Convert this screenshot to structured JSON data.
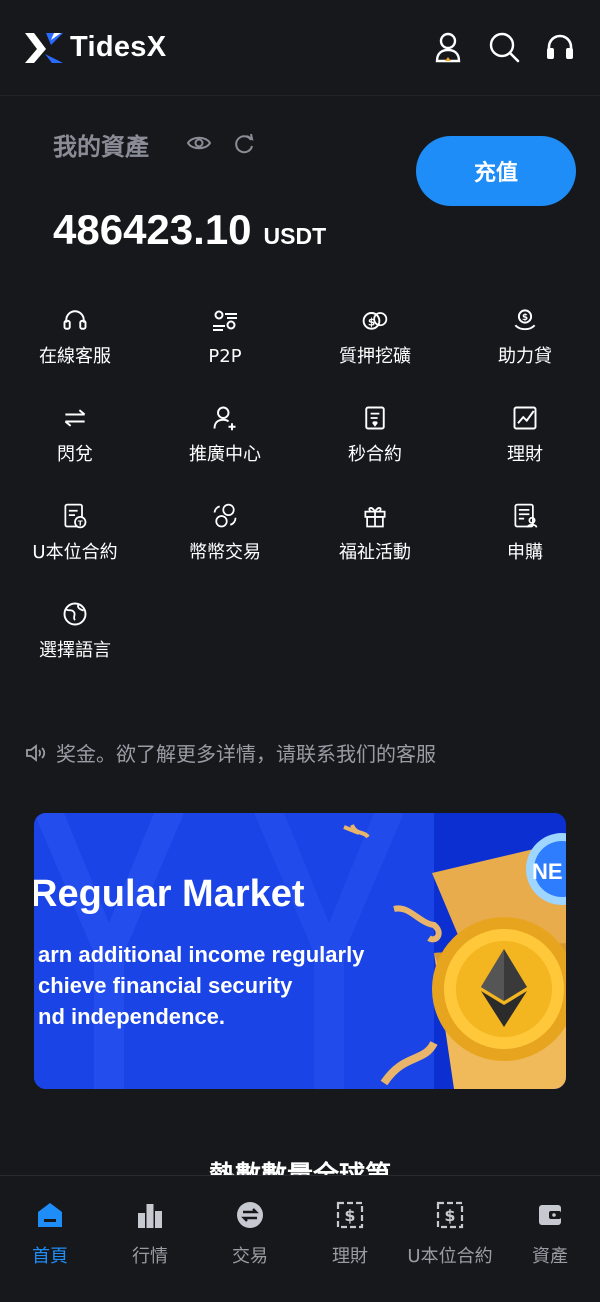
{
  "header": {
    "brand": "TidesX"
  },
  "assets": {
    "title": "我的資產",
    "amount": "486423.10",
    "unit": "USDT",
    "deposit_label": "充值"
  },
  "grid": [
    {
      "label": "在線客服",
      "icon": "headset-icon"
    },
    {
      "label": "P2P",
      "icon": "p2p-icon"
    },
    {
      "label": "質押挖礦",
      "icon": "coins-icon"
    },
    {
      "label": "助力貸",
      "icon": "loan-icon"
    },
    {
      "label": "閃兌",
      "icon": "swap-icon"
    },
    {
      "label": "推廣中心",
      "icon": "user-add-icon"
    },
    {
      "label": "秒合約",
      "icon": "contract-icon"
    },
    {
      "label": "理財",
      "icon": "chart-icon"
    },
    {
      "label": "U本位合約",
      "icon": "u-contract-icon"
    },
    {
      "label": "幣幣交易",
      "icon": "coin-exchange-icon"
    },
    {
      "label": "福祉活動",
      "icon": "gift-icon"
    },
    {
      "label": "申購",
      "icon": "subscribe-icon"
    },
    {
      "label": "選擇語言",
      "icon": "globe-icon"
    }
  ],
  "notice": {
    "text": "奖金。欲了解更多详情，请联系我们的客服"
  },
  "banner": {
    "title": "Regular Market",
    "lines": [
      "arn additional income regularly",
      "chieve financial security",
      "nd independence."
    ],
    "badge": "NE"
  },
  "section": {
    "title": "熱數數量全球第"
  },
  "nav": [
    {
      "label": "首頁",
      "active": true
    },
    {
      "label": "行情",
      "active": false
    },
    {
      "label": "交易",
      "active": false
    },
    {
      "label": "理財",
      "active": false
    },
    {
      "label": "U本位合約",
      "active": false
    },
    {
      "label": "資產",
      "active": false
    }
  ],
  "colors": {
    "accent": "#1f8df7",
    "background": "#17181c",
    "banner": "#1b44e6"
  }
}
